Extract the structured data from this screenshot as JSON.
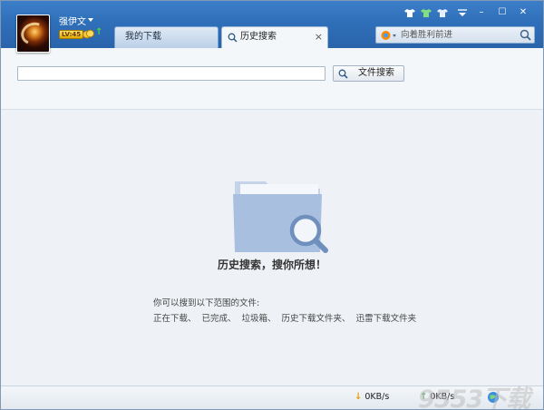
{
  "user": {
    "name": "强伊文",
    "level": "LV:45"
  },
  "tabs": [
    {
      "label": "我的下载",
      "active": false
    },
    {
      "label": "历史搜索",
      "active": true,
      "close": "×"
    }
  ],
  "window_controls": {
    "minimize": "–",
    "maximize": "☐",
    "close": "✕"
  },
  "global_search": {
    "placeholder": "向着胜利前进"
  },
  "file_search": {
    "value": "",
    "button_label": "文件搜索"
  },
  "empty_state": {
    "title": "历史搜索，搜你所想！",
    "hint_intro": "你可以搜到以下范围的文件:",
    "hint_scope": "正在下载、 已完成、 垃圾箱、 历史下载文件夹、 迅雷下载文件夹"
  },
  "status": {
    "download_speed": "0KB/s",
    "upload_speed": "0KB/s"
  },
  "watermark": "9553下载",
  "colors": {
    "titlebar": "#2f6fb9",
    "folder": "#a9bfe0",
    "accent_down": "#e0a100",
    "accent_up": "#47b649"
  }
}
